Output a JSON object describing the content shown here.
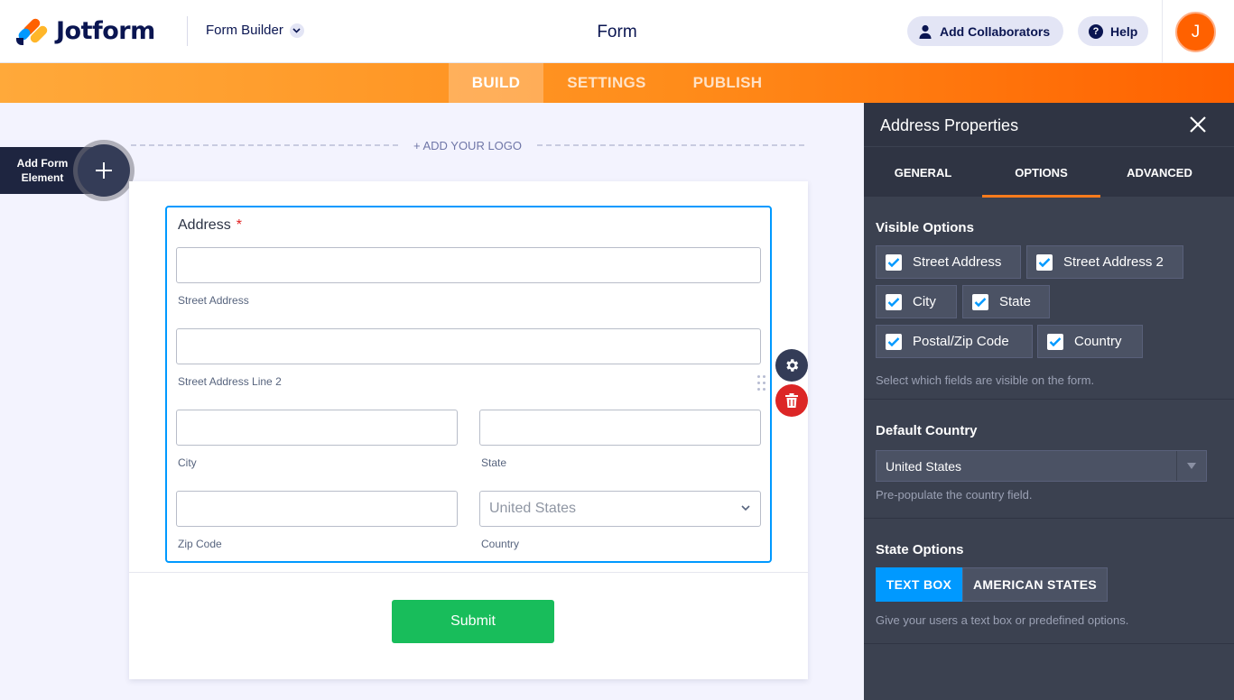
{
  "header": {
    "brand": "Jotform",
    "builder_label": "Form Builder",
    "page_title": "Form",
    "collaborators_label": "Add Collaborators",
    "help_label": "Help",
    "avatar_initial": "J"
  },
  "nav": {
    "tabs": [
      {
        "label": "BUILD",
        "active": true
      },
      {
        "label": "SETTINGS",
        "active": false
      },
      {
        "label": "PUBLISH",
        "active": false
      }
    ]
  },
  "canvas": {
    "add_element_label": "Add Form Element",
    "add_logo_label": "+ ADD YOUR LOGO",
    "address_field": {
      "label": "Address",
      "required_mark": "*",
      "street_sub": "Street Address",
      "street2_sub": "Street Address Line 2",
      "city_sub": "City",
      "state_sub": "State",
      "zip_sub": "Zip Code",
      "country_sub": "Country",
      "country_selected": "United States"
    },
    "submit_label": "Submit"
  },
  "panel": {
    "title": "Address Properties",
    "tabs": [
      {
        "label": "GENERAL",
        "active": false
      },
      {
        "label": "OPTIONS",
        "active": true
      },
      {
        "label": "ADVANCED",
        "active": false
      }
    ],
    "visible_options": {
      "title": "Visible Options",
      "items": [
        {
          "label": "Street Address",
          "checked": true
        },
        {
          "label": "Street Address 2",
          "checked": true
        },
        {
          "label": "City",
          "checked": true
        },
        {
          "label": "State",
          "checked": true
        },
        {
          "label": "Postal/Zip Code",
          "checked": true
        },
        {
          "label": "Country",
          "checked": true
        }
      ],
      "description": "Select which fields are visible on the form."
    },
    "default_country": {
      "title": "Default Country",
      "value": "United States",
      "description": "Pre-populate the country field."
    },
    "state_options": {
      "title": "State Options",
      "options": [
        "TEXT BOX",
        "AMERICAN STATES"
      ],
      "selected": "TEXT BOX",
      "description": "Give your users a text box or predefined options."
    }
  },
  "colors": {
    "accent_orange": "#ff6100",
    "accent_blue": "#0099ff",
    "submit_green": "#18bd5b",
    "panel_bg": "#3b4150",
    "delete_red": "#dc2626"
  }
}
